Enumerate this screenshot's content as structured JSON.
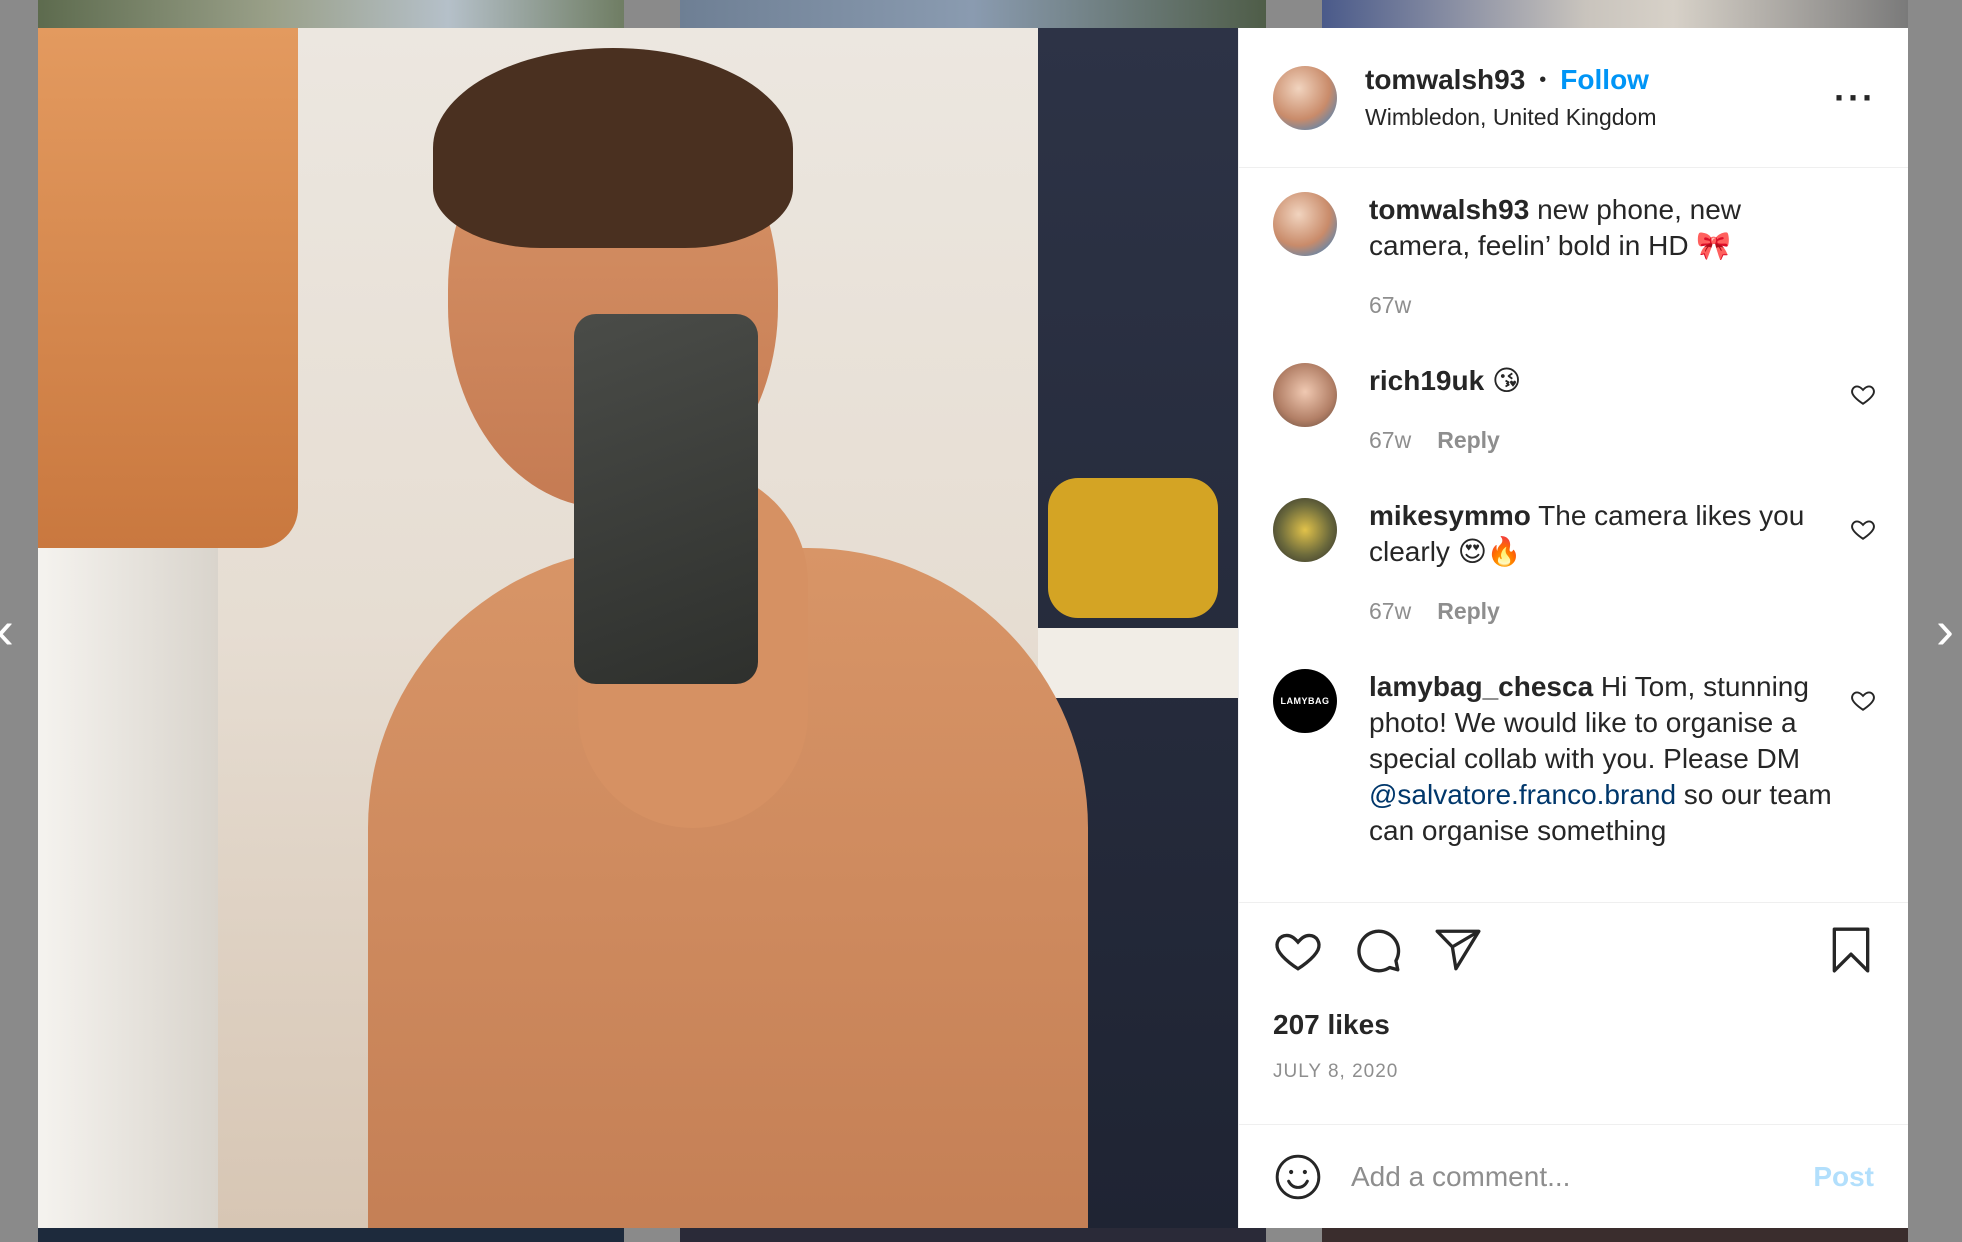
{
  "post": {
    "username": "tomwalsh93",
    "follow_label": "Follow",
    "separator": "•",
    "location": "Wimbledon, United Kingdom",
    "more_icon": "more-options-icon",
    "caption": {
      "username": "tomwalsh93",
      "text": "new phone, new camera, feelin’ bold in HD 🎀",
      "age": "67w"
    },
    "comments": [
      {
        "username": "rich19uk",
        "text": "😘",
        "age": "67w",
        "reply": "Reply"
      },
      {
        "username": "mikesymmo",
        "text": "The camera likes you clearly 😍🔥",
        "age": "67w",
        "reply": "Reply"
      },
      {
        "username": "lamybag_chesca",
        "text_before": "Hi Tom, stunning photo! We would like to organise a special collab with you. Please DM ",
        "mention": "@salvatore.franco.brand",
        "text_after": " so our team can organise something",
        "avatar_text": "LAMYBAG"
      }
    ],
    "likes": "207 likes",
    "date": "JULY 8, 2020",
    "add_comment_placeholder": "Add a comment...",
    "post_label": "Post"
  },
  "nav": {
    "prev": "‹",
    "next": "›"
  },
  "colors": {
    "link_blue": "#0095f6",
    "mention_blue": "#00376b",
    "meta_gray": "#8e8e8e",
    "post_disabled": "#b2dffc"
  }
}
